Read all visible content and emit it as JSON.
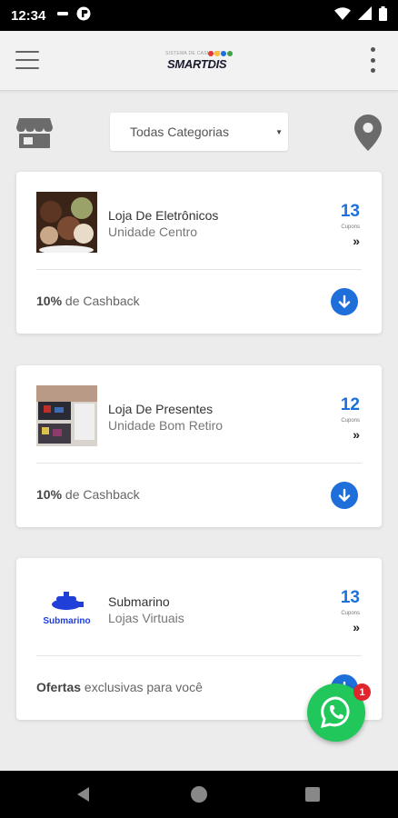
{
  "status_bar": {
    "time": "12:34",
    "left_icons": [
      "minus-icon",
      "info-circle-icon"
    ],
    "right_icons": [
      "wifi-icon",
      "signal-icon",
      "battery-icon"
    ]
  },
  "app_bar": {
    "menu_icon": "hamburger-menu-icon",
    "logo": {
      "tagline": "SISTEMA DE CASHBACK",
      "text": "SMARTDIS",
      "dot_colors": [
        "#e53935",
        "#fbc02d",
        "#1e6fd9",
        "#43a047"
      ]
    },
    "more_icon": "more-vertical-icon"
  },
  "filter": {
    "store_icon": "store-icon",
    "category_selected": "Todas Categorias",
    "location_icon": "map-pin-icon"
  },
  "stores": [
    {
      "name": "Loja De Eletrônicos",
      "unit": "Unidade Centro",
      "coupons": "13",
      "coupons_label": "Cupons",
      "more": "»",
      "offer_bold": "10%",
      "offer_rest": " de Cashback",
      "image": "ice-cream-photo"
    },
    {
      "name": "Loja De Presentes",
      "unit": "Unidade Bom Retiro",
      "coupons": "12",
      "coupons_label": "Cupons",
      "more": "»",
      "offer_bold": "10%",
      "offer_rest": " de Cashback",
      "image": "gift-shop-photo"
    },
    {
      "name": "Submarino",
      "unit": "Lojas Virtuais",
      "coupons": "13",
      "coupons_label": "Cupons",
      "more": "»",
      "offer_bold": "Ofertas",
      "offer_rest": " exclusivas para você",
      "image": "submarino-logo",
      "logo_text": "Submarino"
    }
  ],
  "whatsapp": {
    "icon": "whatsapp-icon",
    "badge": "1"
  },
  "colors": {
    "accent": "#1e6fd9",
    "whatsapp": "#21c75a",
    "badge": "#e0262d"
  }
}
